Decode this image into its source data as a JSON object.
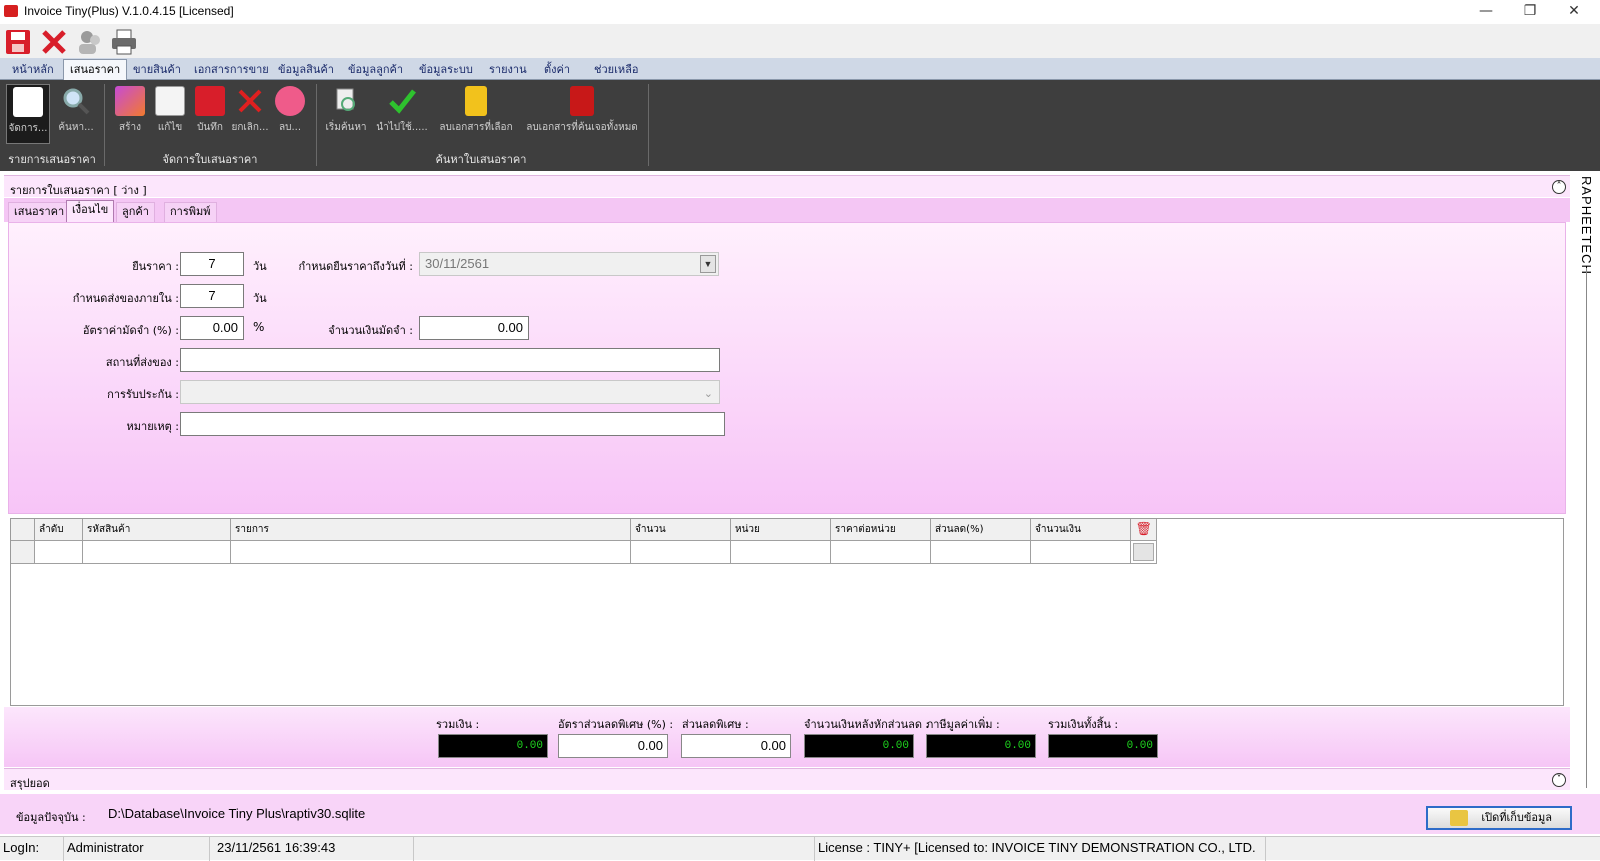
{
  "window": {
    "title": "Invoice Tiny(Plus)  V.1.0.4.15 [Licensed]"
  },
  "quick_toolbar": {
    "icons": [
      "save-icon",
      "close-icon",
      "users-icon",
      "printer-icon"
    ]
  },
  "menu": {
    "tabs": [
      "หน้าหลัก",
      "เสนอราคา",
      "ขายสินค้า",
      "เอกสารการขาย",
      "ข้อมูลสินค้า",
      "ข้อมูลลูกค้า",
      "ข้อมูลระบบ",
      "รายงาน",
      "ตั้งค่า",
      "ช่วยเหลือ"
    ],
    "active": "เสนอราคา"
  },
  "ribbon": {
    "groups": [
      {
        "label": "รายการเสนอราคา",
        "buttons": [
          {
            "label": "จัดการ...",
            "icon": "document-icon"
          },
          {
            "label": "ค้นหา...",
            "icon": "magnifier-icon"
          }
        ]
      },
      {
        "label": "จัดการใบเสนอราคา",
        "buttons": [
          {
            "label": "สร้าง",
            "icon": "new-document-icon"
          },
          {
            "label": "แก้ไข",
            "icon": "edit-icon"
          },
          {
            "label": "บันทึก",
            "icon": "save-icon"
          },
          {
            "label": "ยกเลิก...",
            "icon": "cancel-icon"
          },
          {
            "label": "ลบ...",
            "icon": "delete-icon"
          }
        ]
      },
      {
        "label": "ค้นหาใบเสนอราคา",
        "buttons": [
          {
            "label": "เริ่มค้นหา",
            "icon": "search-start-icon"
          },
          {
            "label": "นำไปใช้.....",
            "icon": "checkmark-icon"
          },
          {
            "label": "ลบเอกสารที่เลือก",
            "icon": "trash-one-icon"
          },
          {
            "label": "ลบเอกสารที่ค้นเจอทั้งหมด",
            "icon": "trash-all-icon"
          }
        ]
      }
    ]
  },
  "panel": {
    "header": "รายการใบเสนอราคา [ ว่าง ]",
    "vertical_brand": "RAPHEETECH",
    "subtabs": [
      "เสนอราคา",
      "เงื่อนไข",
      "ลูกค้า",
      "การพิมพ์"
    ],
    "active_subtab": "เงื่อนไข"
  },
  "form": {
    "price_valid_label": "ยืนราคา :",
    "price_valid_value": "7",
    "price_valid_unit": "วัน",
    "valid_until_label": "กำหนดยืนราคาถึงวันที่ :",
    "valid_until_value": "30/11/2561",
    "delivery_label": "กำหนดส่งของภายใน :",
    "delivery_value": "7",
    "delivery_unit": "วัน",
    "deposit_rate_label": "อัตราค่ามัดจำ (%) :",
    "deposit_rate_value": "0.00",
    "deposit_rate_unit": "%",
    "deposit_amount_label": "จำนวนเงินมัดจำ :",
    "deposit_amount_value": "0.00",
    "delivery_place_label": "สถานที่ส่งของ :",
    "delivery_place_value": "",
    "warranty_label": "การรับประกัน :",
    "warranty_value": "",
    "note_label": "หมายเหตุ :",
    "note_value": ""
  },
  "grid": {
    "columns": [
      "ลำดับ",
      "รหัสสินค้า",
      "รายการ",
      "จำนวน",
      "หน่วย",
      "ราคาต่อหน่วย",
      "ส่วนลด(%)",
      "จำนวนเงิน"
    ]
  },
  "totals": {
    "subtotal_label": "รวมเงิน :",
    "subtotal": "0.00",
    "discount_rate_label": "อัตราส่วนลดพิเศษ (%) :",
    "discount_rate": "0.00",
    "discount_label": "ส่วนลดพิเศษ :",
    "discount": "0.00",
    "after_discount_label": "จำนวนเงินหลังหักส่วนลด :",
    "after_discount": "0.00",
    "vat_label": "ภาษีมูลค่าเพิ่ม :",
    "vat": "0.00",
    "grand_label": "รวมเงินทั้งสิ้น :",
    "grand": "0.00"
  },
  "summary": {
    "label": "สรุปยอด"
  },
  "db": {
    "label": "ข้อมูลปัจจุบัน :",
    "path": "D:\\Database\\Invoice Tiny Plus\\raptiv30.sqlite",
    "open_button": "เปิดที่เก็บข้อมูล"
  },
  "status": {
    "login_label": "LogIn:",
    "user": "Administrator",
    "datetime": "23/11/2561 16:39:43",
    "license": "License : TINY+ [Licensed to: INVOICE TINY DEMONSTRATION CO., LTD."
  }
}
